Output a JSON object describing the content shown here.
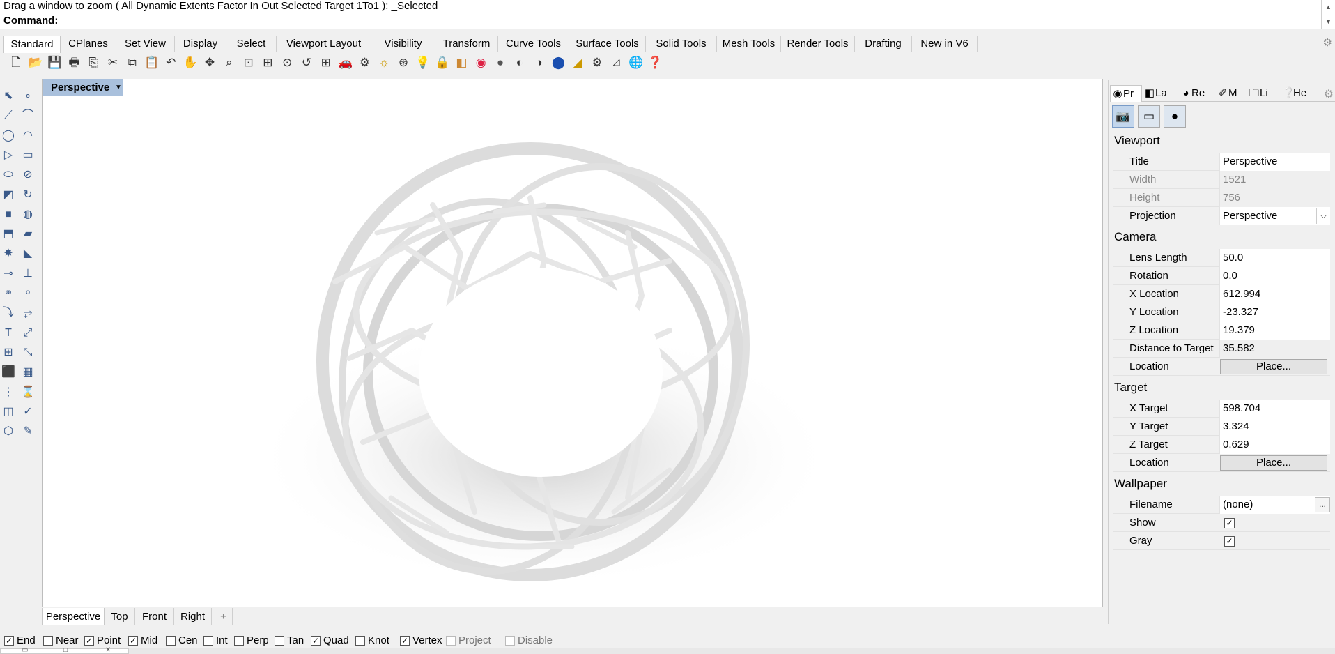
{
  "command_history": "Drag a window to zoom ( All  Dynamic  Extents  Factor  In  Out  Selected  Target  1To1 ): _Selected",
  "command_prompt": "Command:",
  "ribbon_tabs": [
    "Standard",
    "CPlanes",
    "Set View",
    "Display",
    "Select",
    "Viewport Layout",
    "Visibility",
    "Transform",
    "Curve Tools",
    "Surface Tools",
    "Solid Tools",
    "Mesh Tools",
    "Render Tools",
    "Drafting",
    "New in V6"
  ],
  "active_ribbon_tab": "Standard",
  "toolbar_icons": [
    "new-icon",
    "open-icon",
    "save-icon",
    "print-icon",
    "import-icon",
    "cut-icon",
    "copy-icon",
    "paste-icon",
    "undo-icon",
    "pan-icon",
    "rotate-view-icon",
    "zoom-dynamic-icon",
    "zoom-window-icon",
    "zoom-extents-icon",
    "zoom-selected-icon",
    "undo-view-icon",
    "four-viewports-icon",
    "car-icon",
    "options-icon",
    "lights-icon",
    "select-filter-icon",
    "bulb-icon",
    "lock-icon",
    "layer-icon",
    "color-wheel-icon",
    "material-ball-icon",
    "render-preview-icon",
    "render-icon",
    "sphere-icon",
    "clipping-icon",
    "gear-icon",
    "analysis-icon",
    "globe-icon",
    "help-icon"
  ],
  "viewport": {
    "title": "Perspective",
    "tabs": [
      "Perspective",
      "Top",
      "Front",
      "Right"
    ],
    "active_tab": "Perspective",
    "add_tab": "+"
  },
  "osnaps": [
    {
      "label": "End",
      "checked": true,
      "disabled": false
    },
    {
      "label": "Near",
      "checked": false,
      "disabled": false
    },
    {
      "label": "Point",
      "checked": true,
      "disabled": false
    },
    {
      "label": "Mid",
      "checked": true,
      "disabled": false
    },
    {
      "label": "Cen",
      "checked": false,
      "disabled": false
    },
    {
      "label": "Int",
      "checked": false,
      "disabled": false
    },
    {
      "label": "Perp",
      "checked": false,
      "disabled": false
    },
    {
      "label": "Tan",
      "checked": false,
      "disabled": false
    },
    {
      "label": "Quad",
      "checked": true,
      "disabled": false
    },
    {
      "label": "Knot",
      "checked": false,
      "disabled": false
    },
    {
      "label": "Vertex",
      "checked": true,
      "disabled": false
    },
    {
      "label": "Project",
      "checked": false,
      "disabled": true
    },
    {
      "label": "Disable",
      "checked": false,
      "disabled": true
    }
  ],
  "panel": {
    "tabs": [
      {
        "label": "Pr",
        "icon": "properties-icon",
        "active": true
      },
      {
        "label": "La",
        "icon": "layers-icon",
        "active": false
      },
      {
        "label": "Re",
        "icon": "render-icon",
        "active": false
      },
      {
        "label": "M",
        "icon": "materials-icon",
        "active": false
      },
      {
        "label": "Li",
        "icon": "libraries-icon",
        "active": false
      },
      {
        "label": "He",
        "icon": "help-icon",
        "active": false
      }
    ],
    "sections": {
      "viewport": {
        "heading": "Viewport",
        "title_label": "Title",
        "title_value": "Perspective",
        "width_label": "Width",
        "width_value": "1521",
        "height_label": "Height",
        "height_value": "756",
        "projection_label": "Projection",
        "projection_value": "Perspective"
      },
      "camera": {
        "heading": "Camera",
        "lens_label": "Lens Length",
        "lens_value": "50.0",
        "rotation_label": "Rotation",
        "rotation_value": "0.0",
        "xloc_label": "X Location",
        "xloc_value": "612.994",
        "yloc_label": "Y Location",
        "yloc_value": "-23.327",
        "zloc_label": "Z Location",
        "zloc_value": "19.379",
        "dist_label": "Distance to Target",
        "dist_value": "35.582",
        "location_label": "Location",
        "place_button": "Place..."
      },
      "target": {
        "heading": "Target",
        "xt_label": "X Target",
        "xt_value": "598.704",
        "yt_label": "Y Target",
        "yt_value": "3.324",
        "zt_label": "Z Target",
        "zt_value": "0.629",
        "location_label": "Location",
        "place_button": "Place..."
      },
      "wallpaper": {
        "heading": "Wallpaper",
        "filename_label": "Filename",
        "filename_value": "(none)",
        "browse_button": "...",
        "show_label": "Show",
        "show_checked": true,
        "gray_label": "Gray",
        "gray_checked": true
      }
    }
  },
  "colors": {
    "viewport_title_bg": "#a9c0dc",
    "background": "#f0f0f0",
    "ring": "#e4e4e4"
  }
}
